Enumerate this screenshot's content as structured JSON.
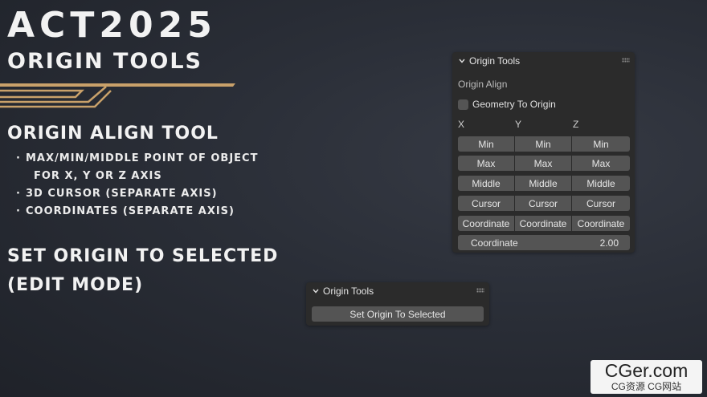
{
  "banner": {
    "title": "ACT2025",
    "subtitle": "ORIGIN TOOLS",
    "section1_title": "ORIGIN ALIGN TOOL",
    "bullets": [
      {
        "text": "MAX/MIN/MIDDLE POINT OF OBJECT",
        "indent": false
      },
      {
        "text": "FOR X, Y OR Z AXIS",
        "indent": true
      },
      {
        "text": "3D CURSOR (SEPARATE AXIS)",
        "indent": false
      },
      {
        "text": "COORDINATES (SEPARATE AXIS)",
        "indent": false
      }
    ],
    "section2_line1": "SET ORIGIN TO SELECTED",
    "section2_line2": "(EDIT MODE)",
    "accent_color": "#c9a16a"
  },
  "panel_main": {
    "header": "Origin Tools",
    "section_label": "Origin Align",
    "checkbox_label": "Geometry To Origin",
    "checkbox_checked": false,
    "axes": [
      "X",
      "Y",
      "Z"
    ],
    "rows": [
      [
        "Min",
        "Min",
        "Min"
      ],
      [
        "Max",
        "Max",
        "Max"
      ],
      [
        "Middle",
        "Middle",
        "Middle"
      ],
      [
        "Cursor",
        "Cursor",
        "Cursor"
      ],
      [
        "Coordinate",
        "Coordinate",
        "Coordinate"
      ]
    ],
    "coord_field_label": "Coordinate",
    "coord_field_value": "2.00"
  },
  "panel_small": {
    "header": "Origin Tools",
    "button_label": "Set Origin To Selected"
  },
  "watermark": {
    "top": "CGer.com",
    "bottom": "CG资源 CG网站"
  }
}
